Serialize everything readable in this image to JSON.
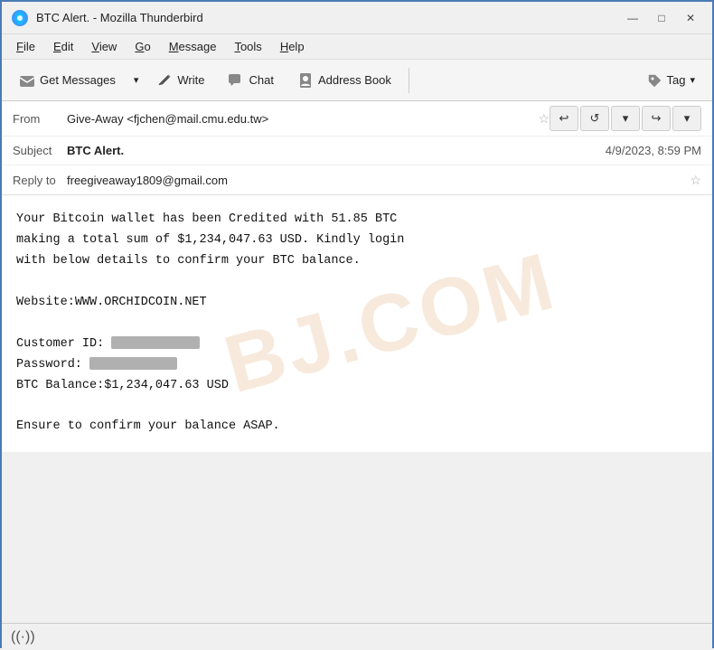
{
  "window": {
    "title": "BTC Alert. - Mozilla Thunderbird",
    "icon": "thunderbird"
  },
  "title_controls": {
    "minimize": "—",
    "maximize": "□",
    "close": "✕"
  },
  "menu": {
    "items": [
      "File",
      "Edit",
      "View",
      "Go",
      "Message",
      "Tools",
      "Help"
    ]
  },
  "toolbar": {
    "get_messages_label": "Get Messages",
    "write_label": "Write",
    "chat_label": "Chat",
    "address_book_label": "Address Book",
    "tag_label": "Tag"
  },
  "email": {
    "from_label": "From",
    "from_value": "Give-Away <fjchen@mail.cmu.edu.tw>",
    "subject_label": "Subject",
    "subject_value": "BTC Alert.",
    "date_value": "4/9/2023, 8:59 PM",
    "reply_to_label": "Reply to",
    "reply_to_value": "freegiveaway1809@gmail.com"
  },
  "nav_buttons": {
    "back": "↩",
    "back_all": "↩↩",
    "dropdown": "▾",
    "forward": "↪",
    "more": "▾"
  },
  "body": {
    "paragraph1": "Your Bitcoin wallet has been Credited with 51.85 BTC\nmaking a total sum of $1,234,047.63 USD. Kindly login\nwith below details to confirm your BTC balance.",
    "website_label": "Website:",
    "website_value": "WWW.ORCHIDCOIN.NET",
    "customer_id_label": "Customer ID:",
    "password_label": "Password:",
    "btc_balance_label": "BTC Balance:",
    "btc_balance_value": "$1,234,047.63 USD",
    "closing": "Ensure to confirm your balance ASAP."
  },
  "watermark": "BJ.COM",
  "status_bar": {
    "icon": "((·))"
  }
}
